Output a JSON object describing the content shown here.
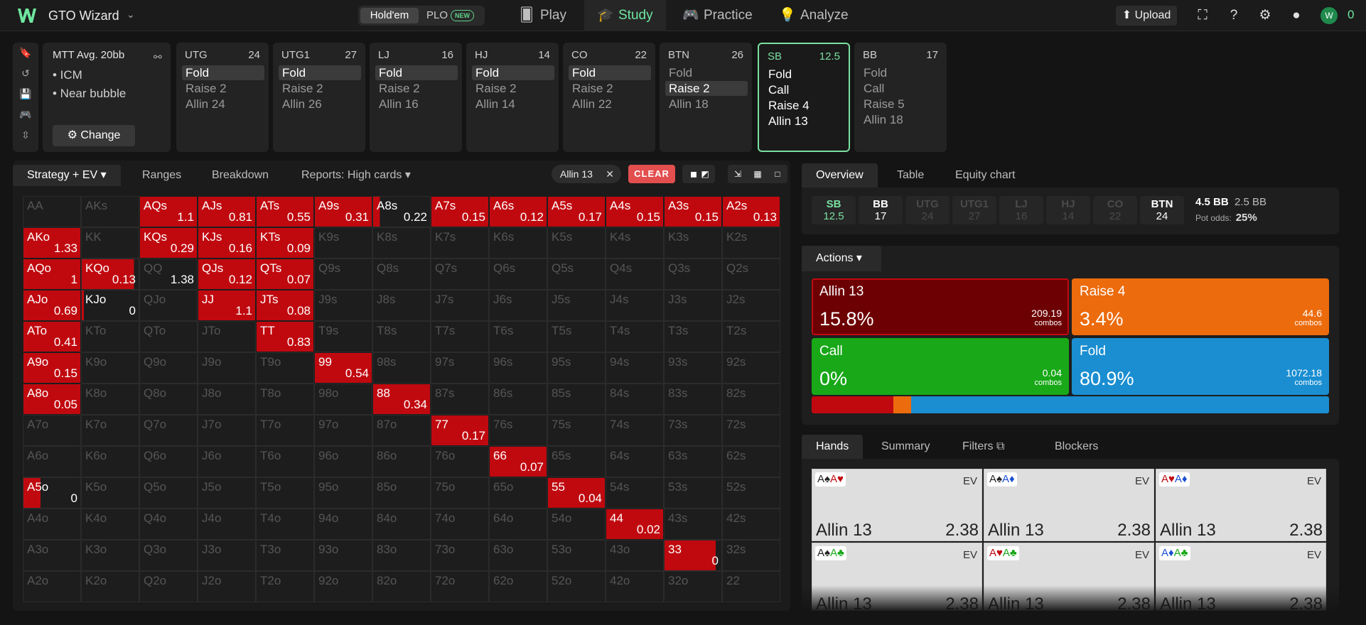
{
  "app": {
    "name": "GTO Wizard"
  },
  "game_toggle": {
    "holdem": "Hold'em",
    "plo": "PLO",
    "new_badge": "NEW"
  },
  "nav": {
    "play": "Play",
    "study": "Study",
    "practice": "Practice",
    "analyze": "Analyze"
  },
  "topright": {
    "upload": "Upload",
    "balance": "0"
  },
  "settings": {
    "title": "MTT Avg. 20bb",
    "items": [
      "• ICM",
      "• Near bubble"
    ],
    "change": "Change"
  },
  "positions": [
    {
      "name": "UTG",
      "stack": "24",
      "actions": [
        "Fold",
        "Raise 2",
        "Allin 24"
      ],
      "selected": 0
    },
    {
      "name": "UTG1",
      "stack": "27",
      "actions": [
        "Fold",
        "Raise 2",
        "Allin 26"
      ],
      "selected": 0
    },
    {
      "name": "LJ",
      "stack": "16",
      "actions": [
        "Fold",
        "Raise 2",
        "Allin 16"
      ],
      "selected": 0
    },
    {
      "name": "HJ",
      "stack": "14",
      "actions": [
        "Fold",
        "Raise 2",
        "Allin 14"
      ],
      "selected": 0
    },
    {
      "name": "CO",
      "stack": "22",
      "actions": [
        "Fold",
        "Raise 2",
        "Allin 22"
      ],
      "selected": 0
    },
    {
      "name": "BTN",
      "stack": "26",
      "actions": [
        "Fold",
        "Raise 2",
        "Allin 18"
      ],
      "selected": 1
    },
    {
      "name": "SB",
      "stack": "12.5",
      "actions": [
        "Fold",
        "Call",
        "Raise 4",
        "Allin 13"
      ],
      "selected": -1,
      "active": true
    },
    {
      "name": "BB",
      "stack": "17",
      "actions": [
        "Fold",
        "Call",
        "Raise 5",
        "Allin 18"
      ],
      "selected": -1
    }
  ],
  "left_tabs": {
    "strategy": "Strategy + EV",
    "ranges": "Ranges",
    "breakdown": "Breakdown",
    "reports": "Reports: High cards"
  },
  "filter_chip": "Allin 13",
  "clear": "CLEAR",
  "matrix": {
    "rows": [
      [
        "AA",
        "AKs",
        "AQs",
        "AJs",
        "ATs",
        "A9s",
        "A8s",
        "A7s",
        "A6s",
        "A5s",
        "A4s",
        "A3s",
        "A2s"
      ],
      [
        "AKo",
        "KK",
        "KQs",
        "KJs",
        "KTs",
        "K9s",
        "K8s",
        "K7s",
        "K6s",
        "K5s",
        "K4s",
        "K3s",
        "K2s"
      ],
      [
        "AQo",
        "KQo",
        "QQ",
        "QJs",
        "QTs",
        "Q9s",
        "Q8s",
        "Q7s",
        "Q6s",
        "Q5s",
        "Q4s",
        "Q3s",
        "Q2s"
      ],
      [
        "AJo",
        "KJo",
        "QJo",
        "JJ",
        "JTs",
        "J9s",
        "J8s",
        "J7s",
        "J6s",
        "J5s",
        "J4s",
        "J3s",
        "J2s"
      ],
      [
        "ATo",
        "KTo",
        "QTo",
        "JTo",
        "TT",
        "T9s",
        "T8s",
        "T7s",
        "T6s",
        "T5s",
        "T4s",
        "T3s",
        "T2s"
      ],
      [
        "A9o",
        "K9o",
        "Q9o",
        "J9o",
        "T9o",
        "99",
        "98s",
        "97s",
        "96s",
        "95s",
        "94s",
        "93s",
        "92s"
      ],
      [
        "A8o",
        "K8o",
        "Q8o",
        "J8o",
        "T8o",
        "98o",
        "88",
        "87s",
        "86s",
        "85s",
        "84s",
        "83s",
        "82s"
      ],
      [
        "A7o",
        "K7o",
        "Q7o",
        "J7o",
        "T7o",
        "97o",
        "87o",
        "77",
        "76s",
        "75s",
        "74s",
        "73s",
        "72s"
      ],
      [
        "A6o",
        "K6o",
        "Q6o",
        "J6o",
        "T6o",
        "96o",
        "86o",
        "76o",
        "66",
        "65s",
        "64s",
        "63s",
        "62s"
      ],
      [
        "A5o",
        "K5o",
        "Q5o",
        "J5o",
        "T5o",
        "95o",
        "85o",
        "75o",
        "65o",
        "55",
        "54s",
        "53s",
        "52s"
      ],
      [
        "A4o",
        "K4o",
        "Q4o",
        "J4o",
        "T4o",
        "94o",
        "84o",
        "74o",
        "64o",
        "54o",
        "44",
        "43s",
        "42s"
      ],
      [
        "A3o",
        "K3o",
        "Q3o",
        "J3o",
        "T3o",
        "93o",
        "83o",
        "73o",
        "63o",
        "53o",
        "43o",
        "33",
        "32s"
      ],
      [
        "A2o",
        "K2o",
        "Q2o",
        "J2o",
        "T2o",
        "92o",
        "82o",
        "72o",
        "62o",
        "52o",
        "42o",
        "32o",
        "22"
      ]
    ],
    "values": {
      "0,2": "1.1",
      "0,3": "0.81",
      "0,4": "0.55",
      "0,5": "0.31",
      "0,6": "0.22",
      "0,7": "0.15",
      "0,8": "0.12",
      "0,9": "0.17",
      "0,10": "0.15",
      "0,11": "0.15",
      "0,12": "0.13",
      "1,0": "1.33",
      "1,2": "0.29",
      "1,3": "0.16",
      "1,4": "0.09",
      "2,0": "1",
      "2,1": "0.13",
      "2,2": "1.38",
      "2,3": "0.12",
      "2,4": "0.07",
      "3,0": "0.69",
      "3,1": "0",
      "3,3": "1.1",
      "3,4": "0.08",
      "4,0": "0.41",
      "4,4": "0.83",
      "5,0": "0.15",
      "5,5": "0.54",
      "6,0": "0.05",
      "6,6": "0.34",
      "7,7": "0.17",
      "8,8": "0.07",
      "9,0": "0",
      "9,9": "0.04",
      "10,10": "0.02",
      "11,11": "0"
    },
    "full": [
      "0,2",
      "0,3",
      "0,4",
      "0,5",
      "0,7",
      "0,8",
      "0,9",
      "0,10",
      "0,11",
      "0,12",
      "1,0",
      "1,2",
      "1,3",
      "1,4",
      "2,0",
      "2,3",
      "2,4",
      "3,0",
      "3,3",
      "3,4",
      "4,0",
      "4,4",
      "5,0",
      "5,5",
      "6,0",
      "6,6",
      "7,7",
      "8,8",
      "9,9",
      "10,10"
    ],
    "partial": {
      "0,6": "12%",
      "2,1": "92%",
      "3,1": "4%",
      "9,0": "30%",
      "11,11": "90%"
    }
  },
  "right_tabs": {
    "overview": "Overview",
    "table": "Table",
    "equity": "Equity chart"
  },
  "seats": [
    {
      "n": "SB",
      "s": "12.5",
      "cls": "sb act"
    },
    {
      "n": "BB",
      "s": "17",
      "cls": "act"
    },
    {
      "n": "UTG",
      "s": "24",
      "cls": ""
    },
    {
      "n": "UTG1",
      "s": "27",
      "cls": ""
    },
    {
      "n": "LJ",
      "s": "16",
      "cls": ""
    },
    {
      "n": "HJ",
      "s": "14",
      "cls": ""
    },
    {
      "n": "CO",
      "s": "22",
      "cls": ""
    },
    {
      "n": "BTN",
      "s": "24",
      "cls": "act"
    }
  ],
  "pot": {
    "pot": "4.5 BB",
    "to_call": "2.5 BB",
    "odds_label": "Pot odds:",
    "odds": "25%"
  },
  "actions_header": "Actions",
  "actions": [
    {
      "name": "Allin 13",
      "pct": "15.8%",
      "combos": "209.19",
      "unit": "combos",
      "color": "#6d0003",
      "border": "#c0090f"
    },
    {
      "name": "Raise 4",
      "pct": "3.4%",
      "combos": "44.6",
      "unit": "combos",
      "color": "#ec6b0d",
      "border": "#ec6b0d"
    },
    {
      "name": "Call",
      "pct": "0%",
      "combos": "0.04",
      "unit": "combos",
      "color": "#18a818",
      "border": "#18a818"
    },
    {
      "name": "Fold",
      "pct": "80.9%",
      "combos": "1072.18",
      "unit": "combos",
      "color": "#1a8ed1",
      "border": "#1a8ed1"
    }
  ],
  "freq": {
    "allin": 0.158,
    "raise": 0.034,
    "call": 0.0,
    "fold": 0.809,
    "c_allin": "#c0090f",
    "c_raise": "#ec6b0d",
    "c_call": "#18a818",
    "c_fold": "#1a8ed1"
  },
  "bottom_tabs": {
    "hands": "Hands",
    "summary": "Summary",
    "filters": "Filters",
    "blockers": "Blockers"
  },
  "hands": [
    {
      "c1": "A♠",
      "c1c": "#222",
      "c2": "A♥",
      "c2c": "#c0090f",
      "ev": "EV",
      "action": "Allin 13",
      "val": "2.38"
    },
    {
      "c1": "A♠",
      "c1c": "#222",
      "c2": "A♦",
      "c2c": "#1a4fd1",
      "ev": "EV",
      "action": "Allin 13",
      "val": "2.38"
    },
    {
      "c1": "A♥",
      "c1c": "#c0090f",
      "c2": "A♦",
      "c2c": "#1a4fd1",
      "ev": "EV",
      "action": "Allin 13",
      "val": "2.38"
    },
    {
      "c1": "A♠",
      "c1c": "#222",
      "c2": "A♣",
      "c2c": "#18a818",
      "ev": "EV",
      "action": "Allin 13",
      "val": "2.38"
    },
    {
      "c1": "A♥",
      "c1c": "#c0090f",
      "c2": "A♣",
      "c2c": "#18a818",
      "ev": "EV",
      "action": "Allin 13",
      "val": "2.38"
    },
    {
      "c1": "A♦",
      "c1c": "#1a4fd1",
      "c2": "A♣",
      "c2c": "#18a818",
      "ev": "EV",
      "action": "Allin 13",
      "val": "2.38"
    }
  ]
}
